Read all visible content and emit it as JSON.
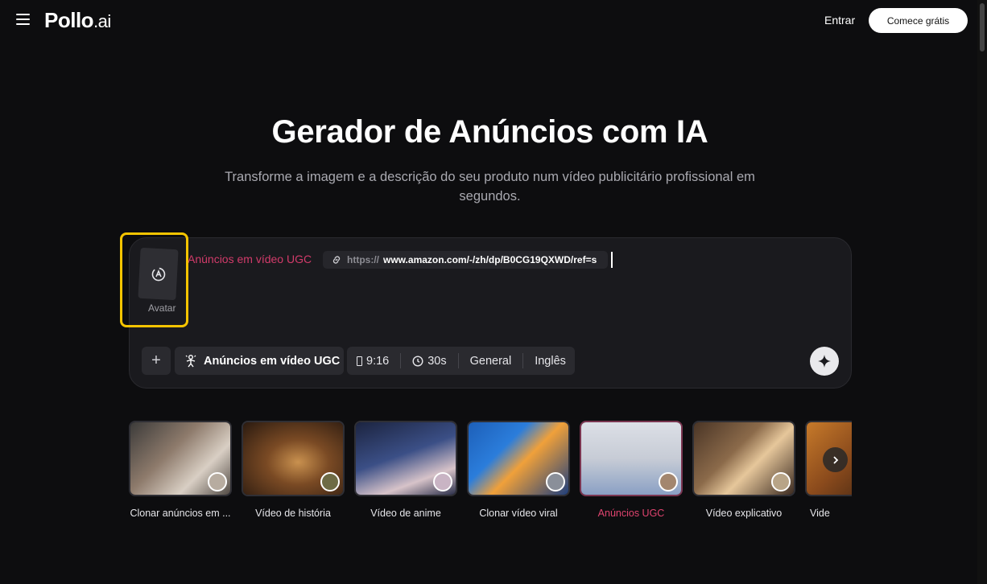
{
  "header": {
    "logo_main": "Pollo",
    "logo_suffix": ".ai",
    "login_label": "Entrar",
    "start_label": "Comece grátis"
  },
  "hero": {
    "title": "Gerador de Anúncios com IA",
    "subtitle": "Transforme a imagem e a descrição do seu produto num vídeo publicitário profissional em segundos."
  },
  "prompt": {
    "avatar_label": "Avatar",
    "tag": "Anúncios em vídeo UGC",
    "url_protocol": "https://",
    "url_address": "www.amazon.com/-/zh/dp/B0CG19QXWD/ref=s"
  },
  "toolbar": {
    "add_label": "+",
    "mode_label": "Anúncios em vídeo UGC",
    "ratio": "9:16",
    "duration": "30s",
    "style": "General",
    "language": "Inglês"
  },
  "templates": [
    {
      "caption": "Clonar anúncios em ..."
    },
    {
      "caption": "Vídeo de história"
    },
    {
      "caption": "Vídeo de anime"
    },
    {
      "caption": "Clonar vídeo viral"
    },
    {
      "caption": "Anúncios UGC"
    },
    {
      "caption": "Vídeo explicativo"
    },
    {
      "caption": "Vide"
    }
  ],
  "colors": {
    "accent_pink": "#d23b6a",
    "highlight_yellow": "#f5c400",
    "background": "#0d0d0f"
  },
  "icons": [
    "menu-icon",
    "link-icon",
    "avatar-swap-icon",
    "ugc-person-icon",
    "ratio-icon",
    "clock-icon",
    "sparkle-icon",
    "chevron-right-icon"
  ]
}
